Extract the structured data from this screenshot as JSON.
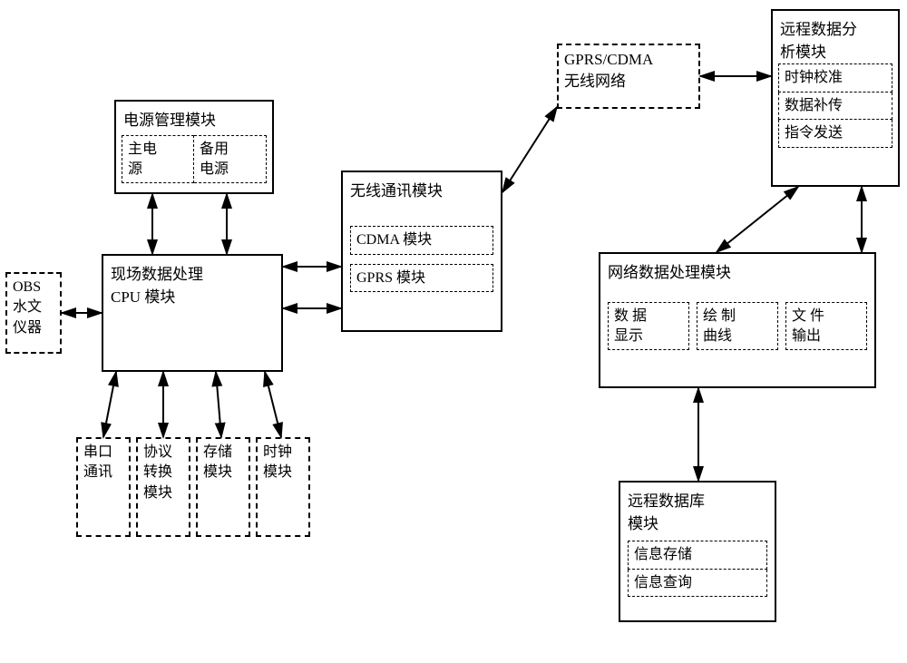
{
  "obs": {
    "label": "OBS\n水文\n仪器"
  },
  "power": {
    "title": "电源管理模块",
    "main": "主电\n源",
    "backup": "备用\n电源"
  },
  "cpu": {
    "title": "现场数据处理\nCPU 模块"
  },
  "periph": {
    "serial": "串口\n通讯",
    "protocol": "协议\n转换\n模块",
    "storage": "存储\n模块",
    "clock": "时钟\n模块"
  },
  "wireless": {
    "title": "无线通讯模块",
    "cdma": "CDMA 模块",
    "gprs": "GPRS 模块"
  },
  "gprscdma": {
    "label": "GPRS/CDMA\n无线网络"
  },
  "remote_analysis": {
    "title": "远程数据分\n析模块",
    "clock": "时钟校准",
    "resend": "数据补传",
    "cmd": "指令发送"
  },
  "netproc": {
    "title": "网络数据处理模块",
    "display": "数 据\n显示",
    "curve": "绘 制\n曲线",
    "file": "文 件\n输出"
  },
  "remotedb": {
    "title": "远程数据库\n模块",
    "store": "信息存储",
    "query": "信息查询"
  }
}
